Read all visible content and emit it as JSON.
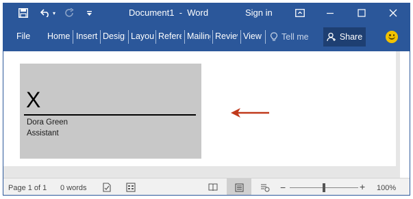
{
  "titlebar": {
    "document_title": "Document1  -  Word",
    "sign_in": "Sign in",
    "icons": [
      "save-icon",
      "undo-icon",
      "redo-icon",
      "customize-qat-icon",
      "ribbon-display-options-icon",
      "minimize-icon",
      "maximize-icon",
      "close-icon"
    ]
  },
  "ribbon": {
    "tabs": [
      {
        "label": "File"
      },
      {
        "label": "Home"
      },
      {
        "label": "Insert"
      },
      {
        "label": "Design"
      },
      {
        "label": "Layout"
      },
      {
        "label": "References"
      },
      {
        "label": "Mailings"
      },
      {
        "label": "Review"
      },
      {
        "label": "View"
      }
    ],
    "tell_me": "Tell me",
    "share": "Share",
    "accent": "#2b579a"
  },
  "document": {
    "signature_line": {
      "x_mark": "X",
      "signer_name": "Dora Green",
      "signer_title": "Assistant"
    },
    "arrow_color": "#c0391b"
  },
  "statusbar": {
    "page": "Page 1 of 1",
    "words": "0 words",
    "zoom": "100%",
    "zoom_fraction": 0.5
  }
}
